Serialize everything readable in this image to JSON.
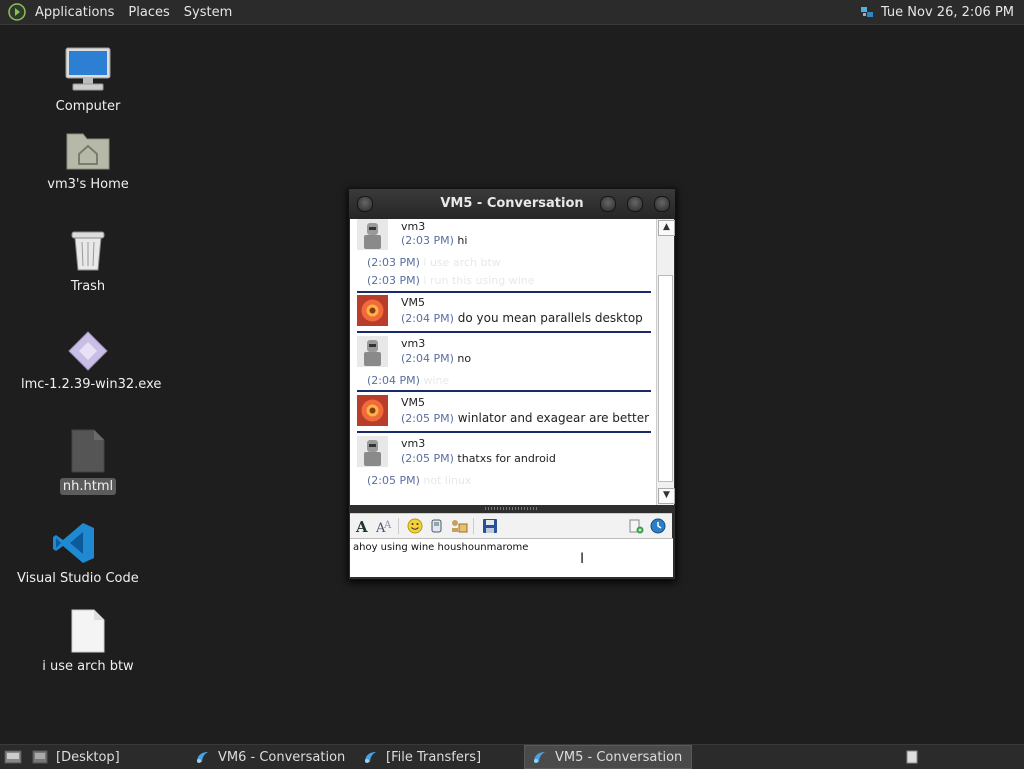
{
  "top_panel": {
    "menus": [
      "Applications",
      "Places",
      "System"
    ],
    "clock": "Tue Nov 26,  2:06 PM"
  },
  "desktop": {
    "icons": [
      {
        "label": "Computer",
        "icon": "computer-icon"
      },
      {
        "label": "vm3's Home",
        "icon": "home-folder-icon"
      },
      {
        "label": "Trash",
        "icon": "trash-icon"
      },
      {
        "label": "lmc-1.2.39-win32.exe",
        "icon": "exe-file-icon"
      },
      {
        "label": "nh.html",
        "icon": "html-file-icon"
      },
      {
        "label": "Visual Studio Code",
        "icon": "vscode-icon"
      },
      {
        "label": "i use arch btw",
        "icon": "text-file-icon"
      }
    ]
  },
  "conversation": {
    "title": "VM5 - Conversation",
    "messages": [
      {
        "sender": "vm3",
        "time": "(2:03 PM)",
        "text": "hi"
      },
      {
        "time": "(2:03 PM)",
        "text": "i use arch btw"
      },
      {
        "time": "(2:03 PM)",
        "text": "i run this using wine"
      },
      {
        "sender": "VM5",
        "time": "(2:04 PM)",
        "text": "do you mean parallels desktop"
      },
      {
        "sender": "vm3",
        "time": "(2:04 PM)",
        "text": "no"
      },
      {
        "time": "(2:04 PM)",
        "text": "wine"
      },
      {
        "sender": "VM5",
        "time": "(2:05 PM)",
        "text": "winlator and exagear are better"
      },
      {
        "sender": "vm3",
        "time": "(2:05 PM)",
        "text": "thatxs for android"
      },
      {
        "time": "(2:05 PM)",
        "text": "not linux"
      }
    ],
    "input_value": "ahoy using wine houshounmarome"
  },
  "taskbar": {
    "tasks": [
      "[Desktop]",
      "VM6 - Conversation",
      "[File Transfers]",
      "VM5 - Conversation"
    ]
  },
  "colors": {
    "desktop_bg": "#1e1e1e",
    "divider": "#1b2a6b",
    "timestamp": "#5a6ea0"
  }
}
